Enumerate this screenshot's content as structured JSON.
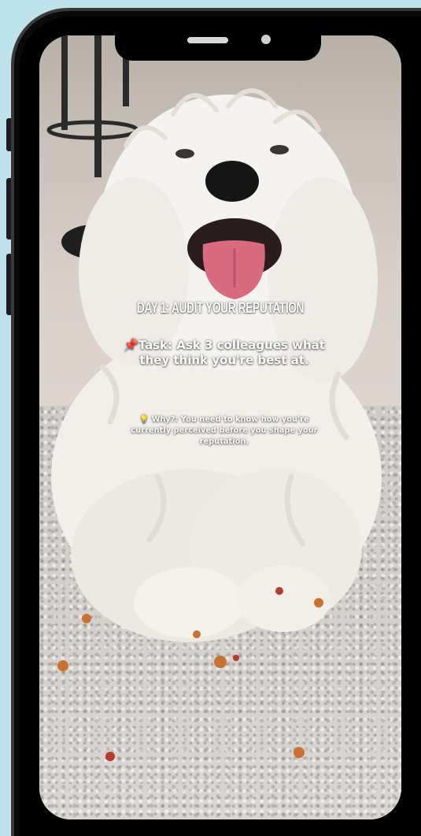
{
  "post": {
    "day_title": "DAY 1: AUDIT YOUR REPUTATION",
    "task_icon": "pushpin-icon",
    "task_text": "Task: Ask 3 colleagues what they think you're best at.",
    "why_icon": "light-bulb-icon",
    "why_text": "Why?: You need to know how you're currently perceived before you shape your reputation."
  },
  "colors": {
    "page_background": "#bfe3ec",
    "phone_frame": "#0a0a0a",
    "overlay_text": "#ffffff"
  }
}
